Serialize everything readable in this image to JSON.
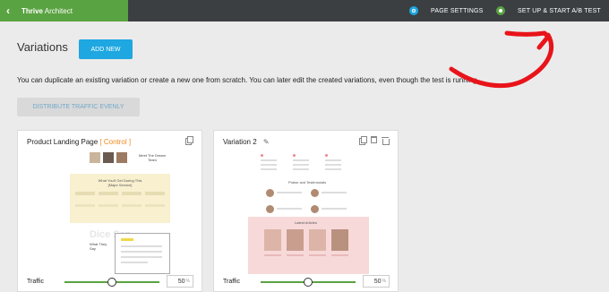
{
  "topbar": {
    "brand_bold": "Thrive",
    "brand_rest": " Architect",
    "page_settings": "PAGE SETTINGS",
    "ab_test": "SET UP & START A/B TEST"
  },
  "colors": {
    "topbar": "#3b3f42",
    "brand": "#5aa342",
    "accent_blue": "#1ea7e1",
    "control_orange": "#f08a1c",
    "annotation_red": "#e8141a"
  },
  "header": {
    "title": "Variations",
    "add_new": "ADD NEW",
    "description": "You can duplicate an existing variation or create a new one from scratch. You can later edit the created variations, even though the test is running.",
    "distribute": "DISTRIBUTE TRAFFIC EVENLY"
  },
  "cards": [
    {
      "title": "Product Landing Page",
      "badge": "[ Control ]",
      "preview": {
        "heading": "Meet The Dream Team",
        "band_title": "What You'll Get During This [Major Service]",
        "watermark": "Dice Sen",
        "side_text": "What They Say"
      },
      "traffic_label": "Traffic",
      "traffic_value": "50",
      "traffic_unit": "%",
      "traffic_fraction": 0.5
    },
    {
      "title": "Variation 2",
      "preview": {
        "section_title": "Praise and Testimonials",
        "articles_title": "Latest Articles"
      },
      "traffic_label": "Traffic",
      "traffic_value": "50",
      "traffic_unit": "%",
      "traffic_fraction": 0.5
    }
  ]
}
